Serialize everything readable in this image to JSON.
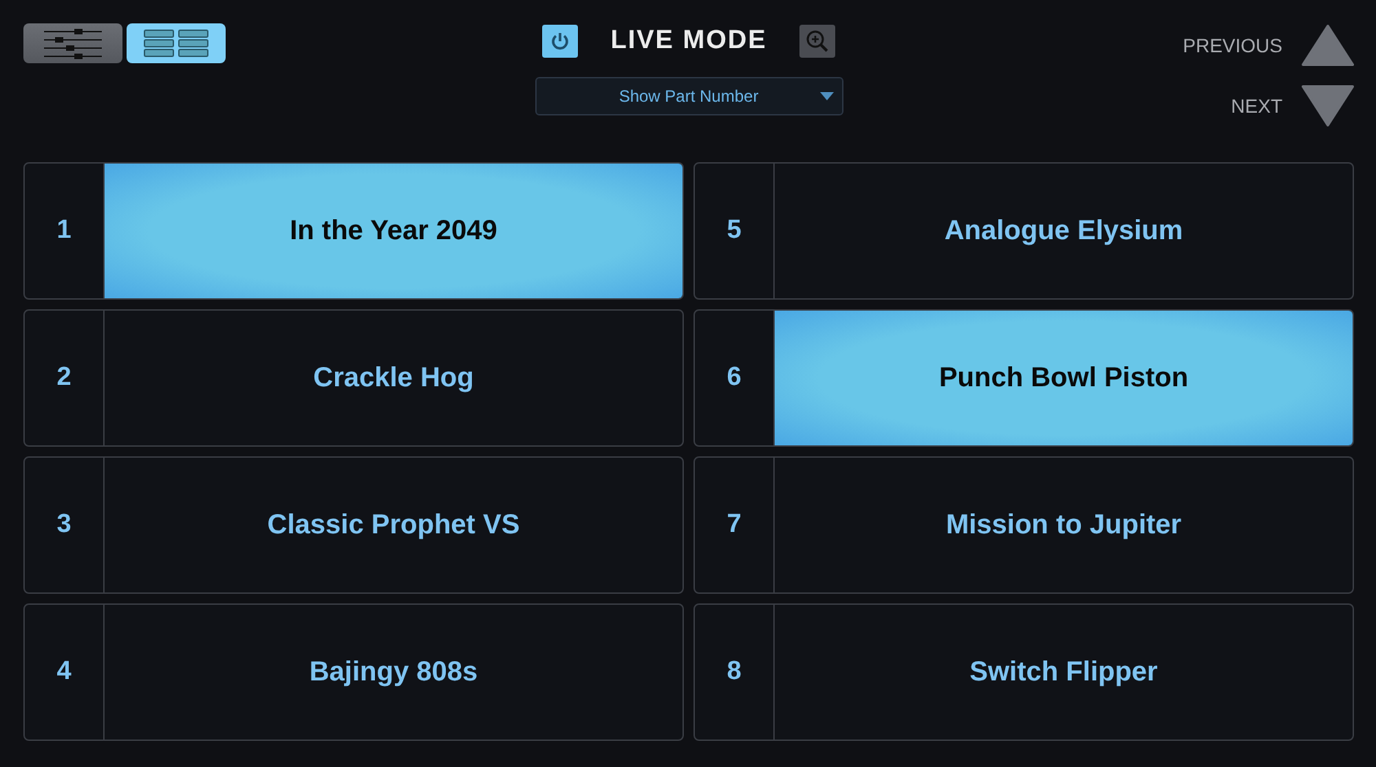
{
  "view_buttons": [
    {
      "kind": "mixer",
      "selected": false
    },
    {
      "kind": "grid",
      "selected": true
    }
  ],
  "power": {
    "on": true
  },
  "title": "LIVE MODE",
  "dropdown": {
    "value": "Show Part Number"
  },
  "nav": [
    {
      "label": "PREVIOUS",
      "kind": "up"
    },
    {
      "label": "NEXT",
      "kind": "down"
    }
  ],
  "parts": [
    {
      "number": "1",
      "name": "In the Year 2049",
      "selected": true
    },
    {
      "number": "2",
      "name": "Crackle Hog",
      "selected": false
    },
    {
      "number": "3",
      "name": "Classic Prophet VS",
      "selected": false
    },
    {
      "number": "4",
      "name": "Bajingy 808s",
      "selected": false
    },
    {
      "number": "5",
      "name": "Analogue Elysium",
      "selected": false
    },
    {
      "number": "6",
      "name": "Punch Bowl Piston",
      "selected": true
    },
    {
      "number": "7",
      "name": "Mission to Jupiter",
      "selected": false
    },
    {
      "number": "8",
      "name": "Switch Flipper",
      "selected": false
    }
  ]
}
